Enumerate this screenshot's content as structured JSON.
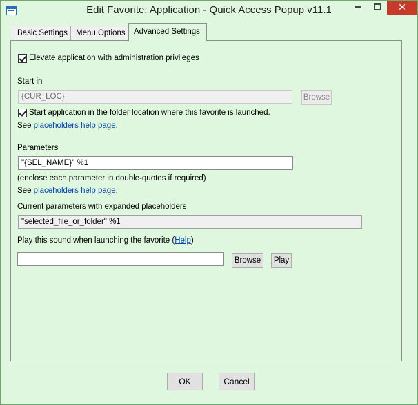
{
  "window": {
    "title": "Edit Favorite: Application - Quick Access Popup v11.1",
    "close_glyph": "✕"
  },
  "tabs": [
    {
      "label": "Basic Settings"
    },
    {
      "label": "Menu Options"
    },
    {
      "label": "Advanced Settings",
      "selected": true
    }
  ],
  "advanced": {
    "elevate_label": "Elevate application with administration privileges",
    "elevate_checked": true,
    "start_in_label": "Start in",
    "start_in_value": "{CUR_LOC}",
    "start_in_browse": "Browse",
    "start_in_folder_label": "Start application in the folder location where this favorite is launched.",
    "start_in_folder_checked": true,
    "see_prefix_1": "See ",
    "placeholders_link_1": "placeholders help page",
    "see_suffix_1": ".",
    "parameters_label": "Parameters",
    "parameters_value": "\"{SEL_NAME}\" %1",
    "enclose_note": "(enclose each parameter in double-quotes if required)",
    "see_prefix_2": "See ",
    "placeholders_link_2": "placeholders help page",
    "see_suffix_2": ".",
    "expanded_label": "Current parameters with expanded placeholders",
    "expanded_value": "\"selected_file_or_folder\" %1",
    "sound_label_prefix": "Play this sound when launching the favorite (",
    "sound_help_link": "Help",
    "sound_label_suffix": ")",
    "sound_value": "",
    "sound_browse": "Browse",
    "sound_play": "Play"
  },
  "footer": {
    "ok": "OK",
    "cancel": "Cancel"
  },
  "colors": {
    "background": "#dff7df",
    "close_button": "#c7392b",
    "link": "#0645ad"
  }
}
